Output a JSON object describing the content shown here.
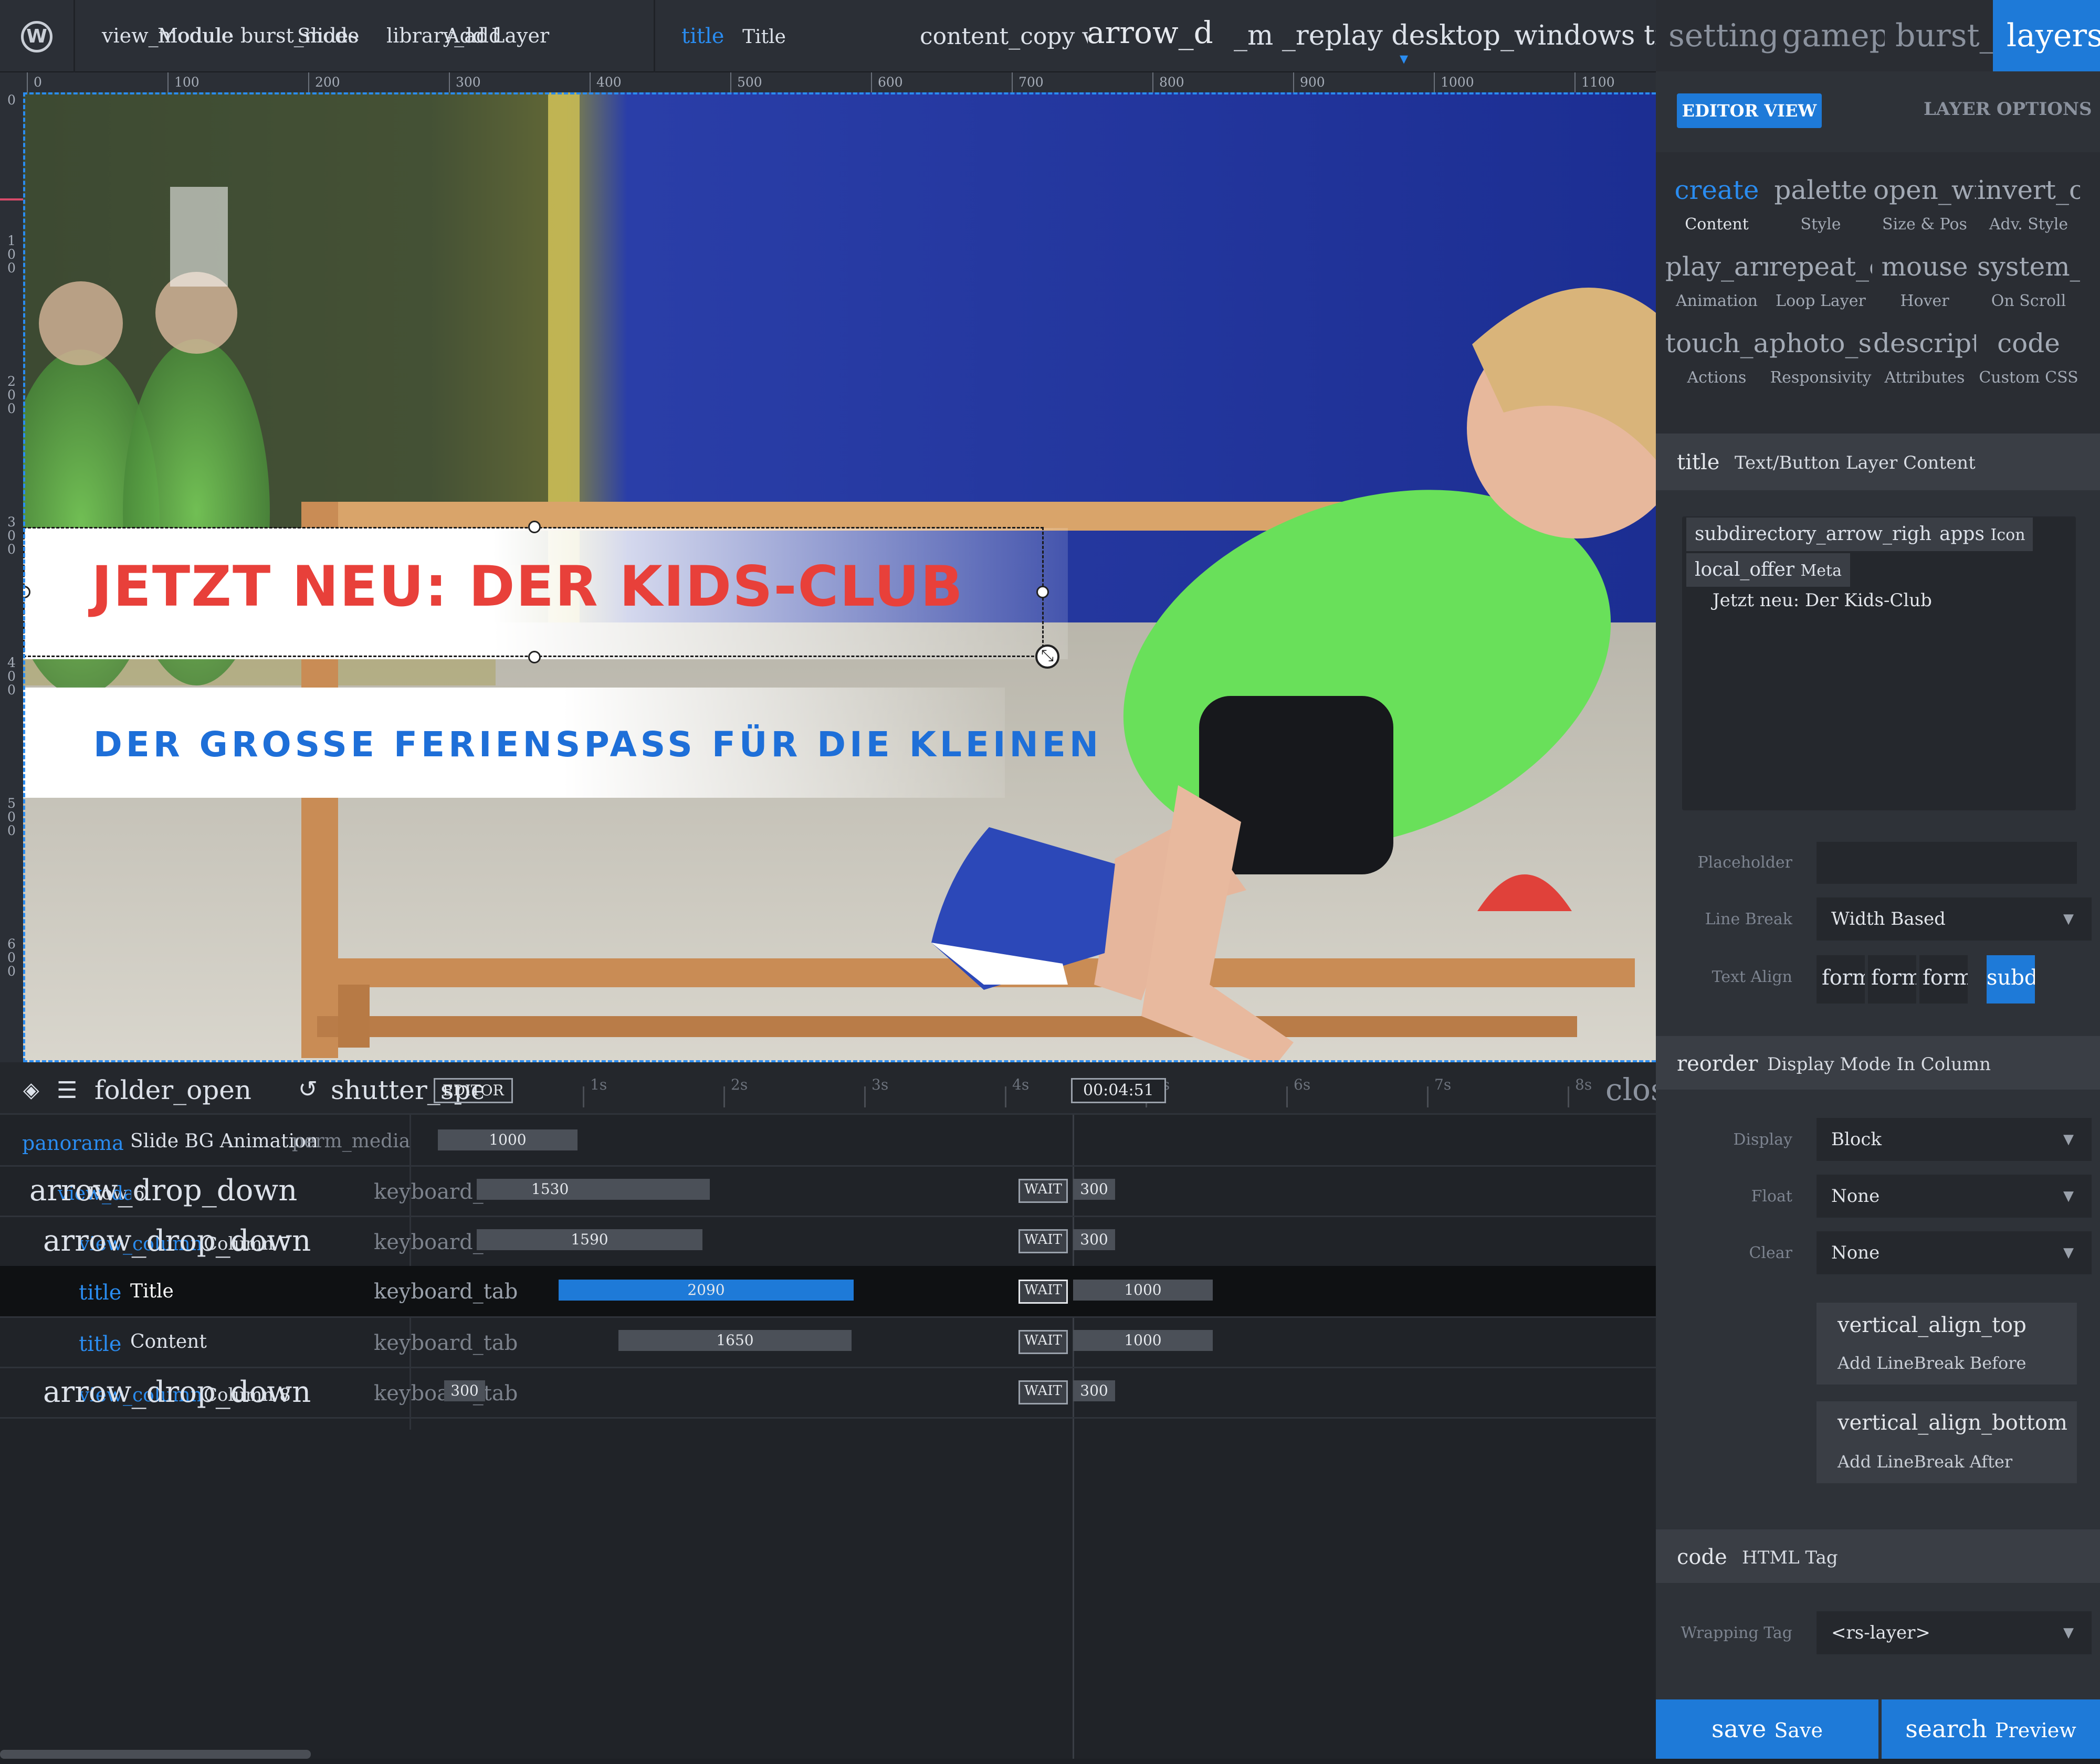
{
  "topbar": {
    "wp": "W",
    "view_icon": "view_module",
    "view_label": "Module",
    "burst_icon": "burst_mode",
    "burst_label": "Slides",
    "library_icon": "library_add",
    "library_label": "Add Layer",
    "current_icon": "title",
    "current_label": "Title",
    "tools_text": "content_copy visibility arrow_drop_down",
    "arrow_big": "arrow_d",
    "more_text": "_m _replay desktop_windows timeline invert",
    "dropdown_caret": "▾"
  },
  "right_tabs": [
    "settings",
    "gamepad",
    "burst_mode",
    "layers"
  ],
  "view_toggle": {
    "editor": "EDITOR VIEW",
    "layer_options": "LAYER OPTIONS"
  },
  "nav": [
    {
      "icon": "create",
      "label": "Content"
    },
    {
      "icon": "palette",
      "label": "Style"
    },
    {
      "icon": "open_with",
      "label": "Size & Pos"
    },
    {
      "icon": "invert_colors",
      "label": "Adv. Style"
    },
    {
      "icon": "play_arrow",
      "label": "Animation"
    },
    {
      "icon": "repeat_one",
      "label": "Loop Layer"
    },
    {
      "icon": "mouse",
      "label": "Hover"
    },
    {
      "icon": "system_update",
      "label": "On Scroll"
    },
    {
      "icon": "touch_app",
      "label": "Actions"
    },
    {
      "icon": "photo_size_select",
      "label": "Responsivity"
    },
    {
      "icon": "description",
      "label": "Attributes"
    },
    {
      "icon": "code",
      "label": "Custom CSS"
    }
  ],
  "content_section": {
    "icon": "title",
    "title": "Text/Button Layer Content",
    "chip1_icon": "subdirectory_arrow_right",
    "chip2_icon": "apps",
    "chip2_label": "Icon",
    "chip3_icon": "local_offer",
    "chip3_label": "Meta",
    "text": "Jetzt neu: Der Kids-Club",
    "placeholder_label": "Placeholder",
    "linebreak_label": "Line Break",
    "linebreak_value": "Width Based",
    "textalign_label": "Text Align",
    "textalign_buttons": [
      "format_align_left",
      "format_align_center",
      "format_align_right",
      "subdirectory_arrow_right"
    ]
  },
  "display_section": {
    "icon": "reorder",
    "title": "Display Mode In Column",
    "display_label": "Display",
    "display_value": "Block",
    "float_label": "Float",
    "float_value": "None",
    "clear_label": "Clear",
    "clear_value": "None",
    "before_icon": "vertical_align_top",
    "before_label": "Add LineBreak Before",
    "after_icon": "vertical_align_bottom",
    "after_label": "Add LineBreak After"
  },
  "html_section": {
    "icon": "code",
    "title": "HTML Tag",
    "tag_label": "Wrapping Tag",
    "tag_value": "<rs-layer>"
  },
  "footer": {
    "save_icon": "save",
    "save_label": "Save",
    "preview_icon": "search",
    "preview_label": "Preview"
  },
  "slide": {
    "headline": "JETZT NEU: DER KIDS-CLUB",
    "subline": "DER GROSSE FERIENSPASS FÜR DIE KLEINEN"
  },
  "ruler_top": [
    "0",
    "100",
    "200",
    "300",
    "400",
    "500",
    "600",
    "700",
    "800",
    "900",
    "1000",
    "1100"
  ],
  "ruler_left": [
    "0",
    "100",
    "200",
    "300",
    "400",
    "500",
    "600"
  ],
  "timeline": {
    "toolbar": {
      "layers_icon": "layers",
      "list_icon": "list",
      "folder_icon": "folder_open",
      "speed_icon": "shutter_speed",
      "play_text": "play_arrow",
      "badge": "EDITOR",
      "time": "00:04:51",
      "close": "close"
    },
    "ticks": [
      "1s",
      "2s",
      "3s",
      "4s",
      "5s",
      "6s",
      "7s",
      "8s"
    ],
    "rows": [
      {
        "icon": "panorama",
        "name": "Slide BG Animation",
        "extra": "perm_media",
        "bar": "1000"
      },
      {
        "expander": "arrow_drop_down",
        "icon": "view_day",
        "name": "Row 6",
        "kind": "keyboard_tab",
        "bar": "1530",
        "wait": "WAIT",
        "waitval": "300"
      },
      {
        "expander": "arrow_drop_down",
        "icon": "view_column",
        "name": "Column 7",
        "kind": "keyboard_tab",
        "bar": "1590",
        "wait": "WAIT",
        "waitval": "300"
      },
      {
        "icon": "title",
        "name": "Title",
        "kind": "keyboard_tab",
        "bar": "2090",
        "wait": "WAIT",
        "waitval": "1000"
      },
      {
        "icon": "title",
        "name": "Content",
        "kind": "keyboard_tab",
        "bar": "1650",
        "wait": "WAIT",
        "waitval": "1000"
      },
      {
        "expander": "arrow_drop_down",
        "icon": "view_column",
        "name": "Column 8",
        "kind": "keyboard_tab",
        "bar": "300",
        "wait": "WAIT",
        "waitval": "300"
      }
    ]
  },
  "colors": {
    "accent": "#1e7ad8",
    "headline": "#e8403a",
    "subline": "#1e6fd8",
    "panel": "#2e3238"
  }
}
